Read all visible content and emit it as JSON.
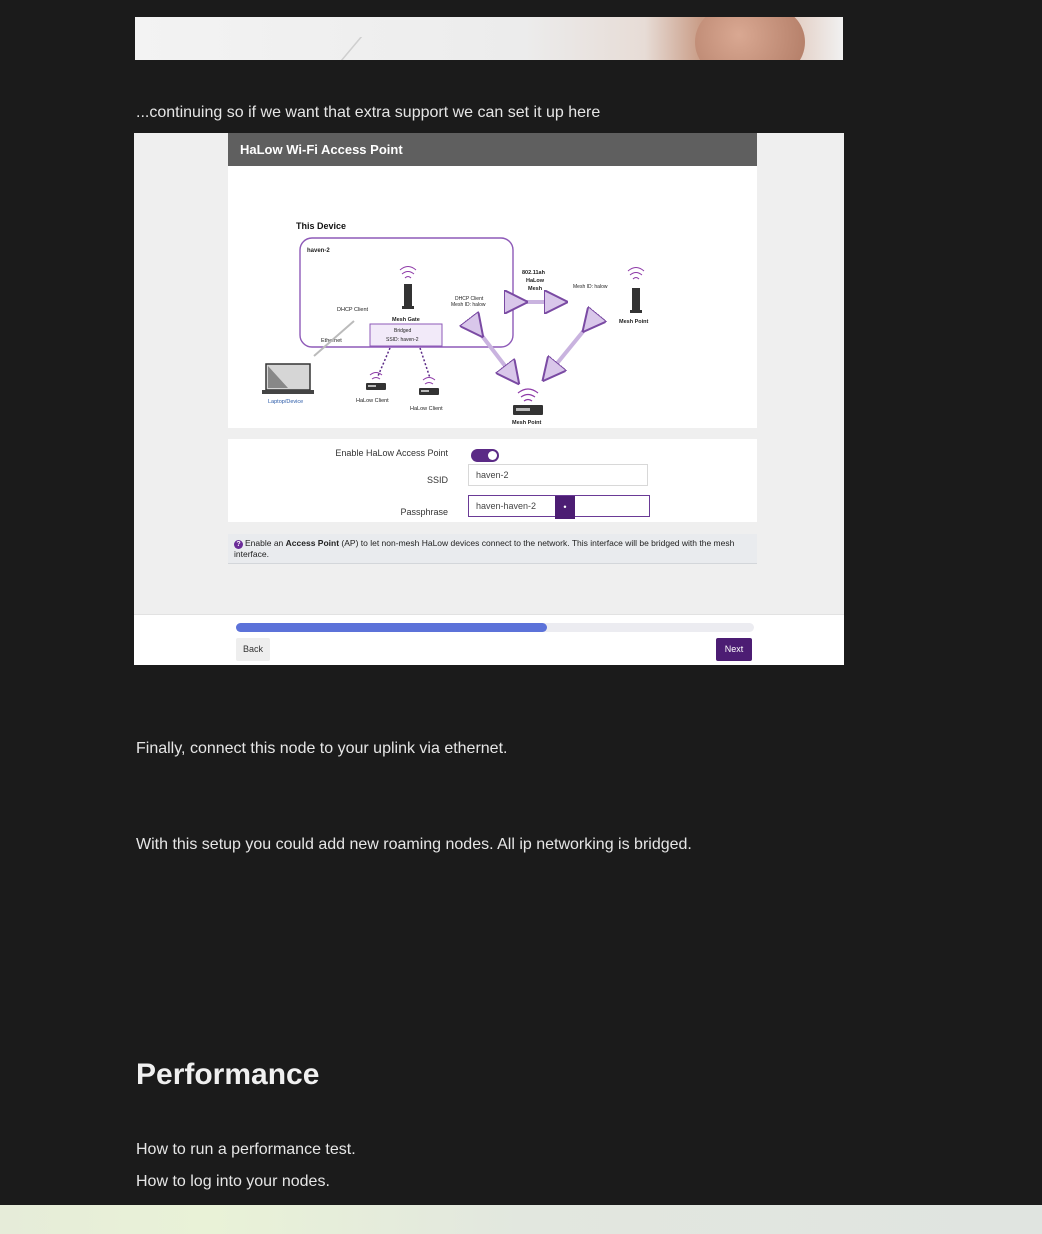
{
  "captions": {
    "continuing": "...continuing so if we want that extra support we can set it up here",
    "finally": "Finally, connect this node to your uplink via ethernet.",
    "roaming": "With this setup you could add new roaming nodes. All ip networking is bridged."
  },
  "screenshot": {
    "header_title": "HaLow Wi-Fi Access Point",
    "diagram": {
      "this_device": "This Device",
      "device_name": "haven-2",
      "dhcp_client_left": "DHCP Client",
      "mesh_gate": "Mesh Gate",
      "ethernet": "Ethernet",
      "bridged": "Bridged",
      "bridged_ssid": "SSID: haven-2",
      "dhcp_client_right": "DHCP Client",
      "dhcp_mesh_id": "Mesh ID: halow",
      "mesh_label_1": "802.11ah",
      "mesh_label_2": "HaLow",
      "mesh_label_3": "Mesh",
      "mesh_id_right": "Mesh ID: halow",
      "mesh_point_right": "Mesh Point",
      "mesh_point_bottom": "Mesh Point",
      "laptop": "Laptop/Device",
      "halow_client_1": "HaLow Client",
      "halow_client_2": "HaLow Client"
    },
    "form": {
      "enable_label": "Enable HaLow Access Point",
      "enable_on": true,
      "ssid_label": "SSID",
      "ssid_value": "haven-2",
      "passphrase_label": "Passphrase",
      "passphrase_value": "haven-haven-2",
      "eye_glyph": "•"
    },
    "info": {
      "icon": "?",
      "pre": "Enable an ",
      "bold": "Access Point",
      "post": " (AP) to let non-mesh HaLow devices connect to the network. This interface will be bridged with the mesh interface."
    },
    "progress_fraction": 0.6,
    "back_label": "Back",
    "next_label": "Next",
    "colors": {
      "accent": "#4c1d73",
      "progress": "#5c72d9",
      "header": "#5f5f5f"
    }
  },
  "performance": {
    "heading": "Performance",
    "line1": "How to run a performance test.",
    "line2": "How to log into your nodes."
  }
}
